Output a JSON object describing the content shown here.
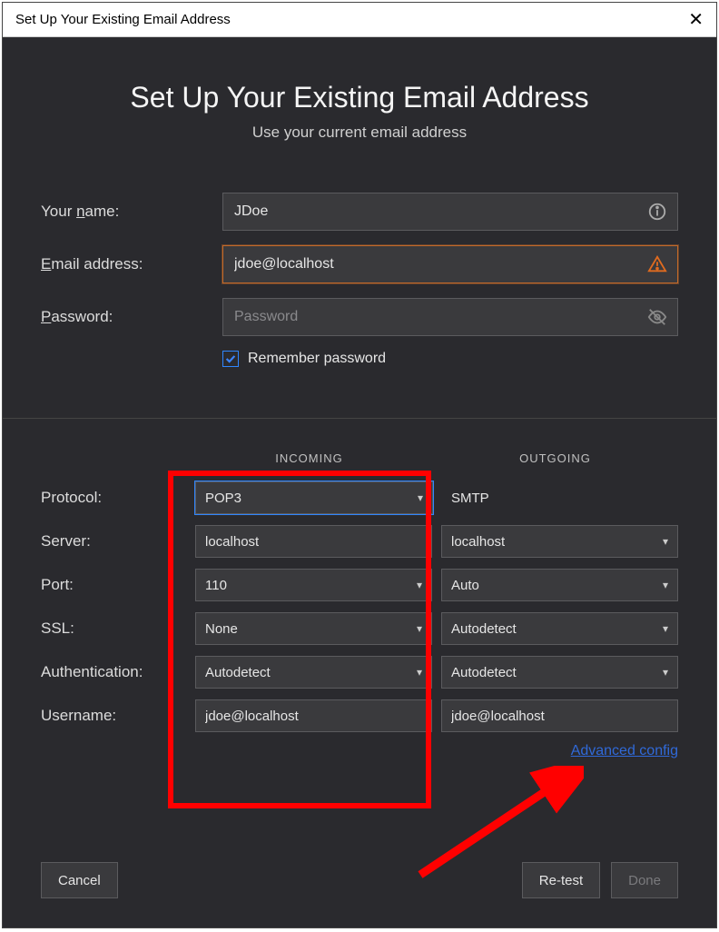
{
  "window": {
    "title": "Set Up Your Existing Email Address"
  },
  "header": {
    "title": "Set Up Your Existing Email Address",
    "subtitle": "Use your current email address"
  },
  "form": {
    "name_label": "Your name:",
    "name_value": "JDoe",
    "email_label": "Email address:",
    "email_value": "jdoe@localhost",
    "password_label": "Password:",
    "password_placeholder": "Password",
    "remember_label": "Remember password",
    "remember_checked": true
  },
  "columns": {
    "incoming": "INCOMING",
    "outgoing": "OUTGOING"
  },
  "labels": {
    "protocol": "Protocol:",
    "server": "Server:",
    "port": "Port:",
    "ssl": "SSL:",
    "auth": "Authentication:",
    "username": "Username:"
  },
  "incoming": {
    "protocol": "POP3",
    "server": "localhost",
    "port": "110",
    "ssl": "None",
    "auth": "Autodetect",
    "username": "jdoe@localhost"
  },
  "outgoing": {
    "protocol": "SMTP",
    "server": "localhost",
    "port": "Auto",
    "ssl": "Autodetect",
    "auth": "Autodetect",
    "username": "jdoe@localhost"
  },
  "links": {
    "advanced": "Advanced config"
  },
  "buttons": {
    "cancel": "Cancel",
    "retest": "Re-test",
    "done": "Done"
  }
}
